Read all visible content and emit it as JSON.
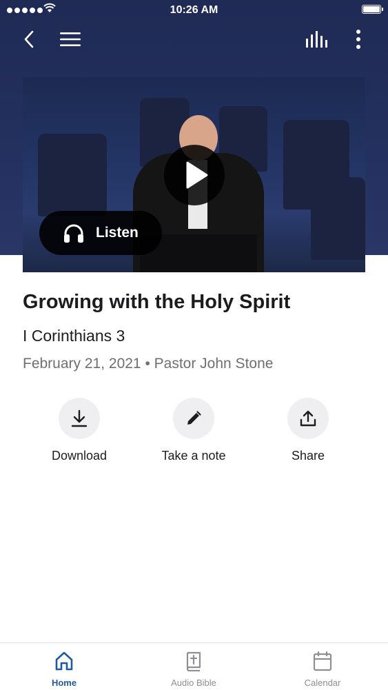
{
  "status_bar": {
    "time": "10:26 AM"
  },
  "nav": {
    "back_icon": "chevron-left-icon",
    "menu_icon": "hamburger-menu-icon",
    "audio_icon": "audio-levels-icon",
    "more_icon": "more-vertical-icon"
  },
  "video": {
    "play_icon": "play-icon",
    "listen_icon": "headphones-icon",
    "listen_label": "Listen"
  },
  "sermon": {
    "title": "Growing with the Holy Spirit",
    "passage": "I Corinthians 3",
    "date": "February 21, 2021",
    "separator": "•",
    "speaker": "Pastor John Stone"
  },
  "actions": [
    {
      "label": "Download",
      "icon": "download-icon"
    },
    {
      "label": "Take a note",
      "icon": "pencil-icon"
    },
    {
      "label": "Share",
      "icon": "share-icon"
    }
  ],
  "tabs": [
    {
      "label": "Home",
      "icon": "home-icon",
      "active": true
    },
    {
      "label": "Audio Bible",
      "icon": "bible-icon",
      "active": false
    },
    {
      "label": "Calendar",
      "icon": "calendar-icon",
      "active": false
    }
  ],
  "colors": {
    "hero_bg": "#1f2a55",
    "accent": "#1f5b9c",
    "muted_text": "#6e6e73"
  }
}
